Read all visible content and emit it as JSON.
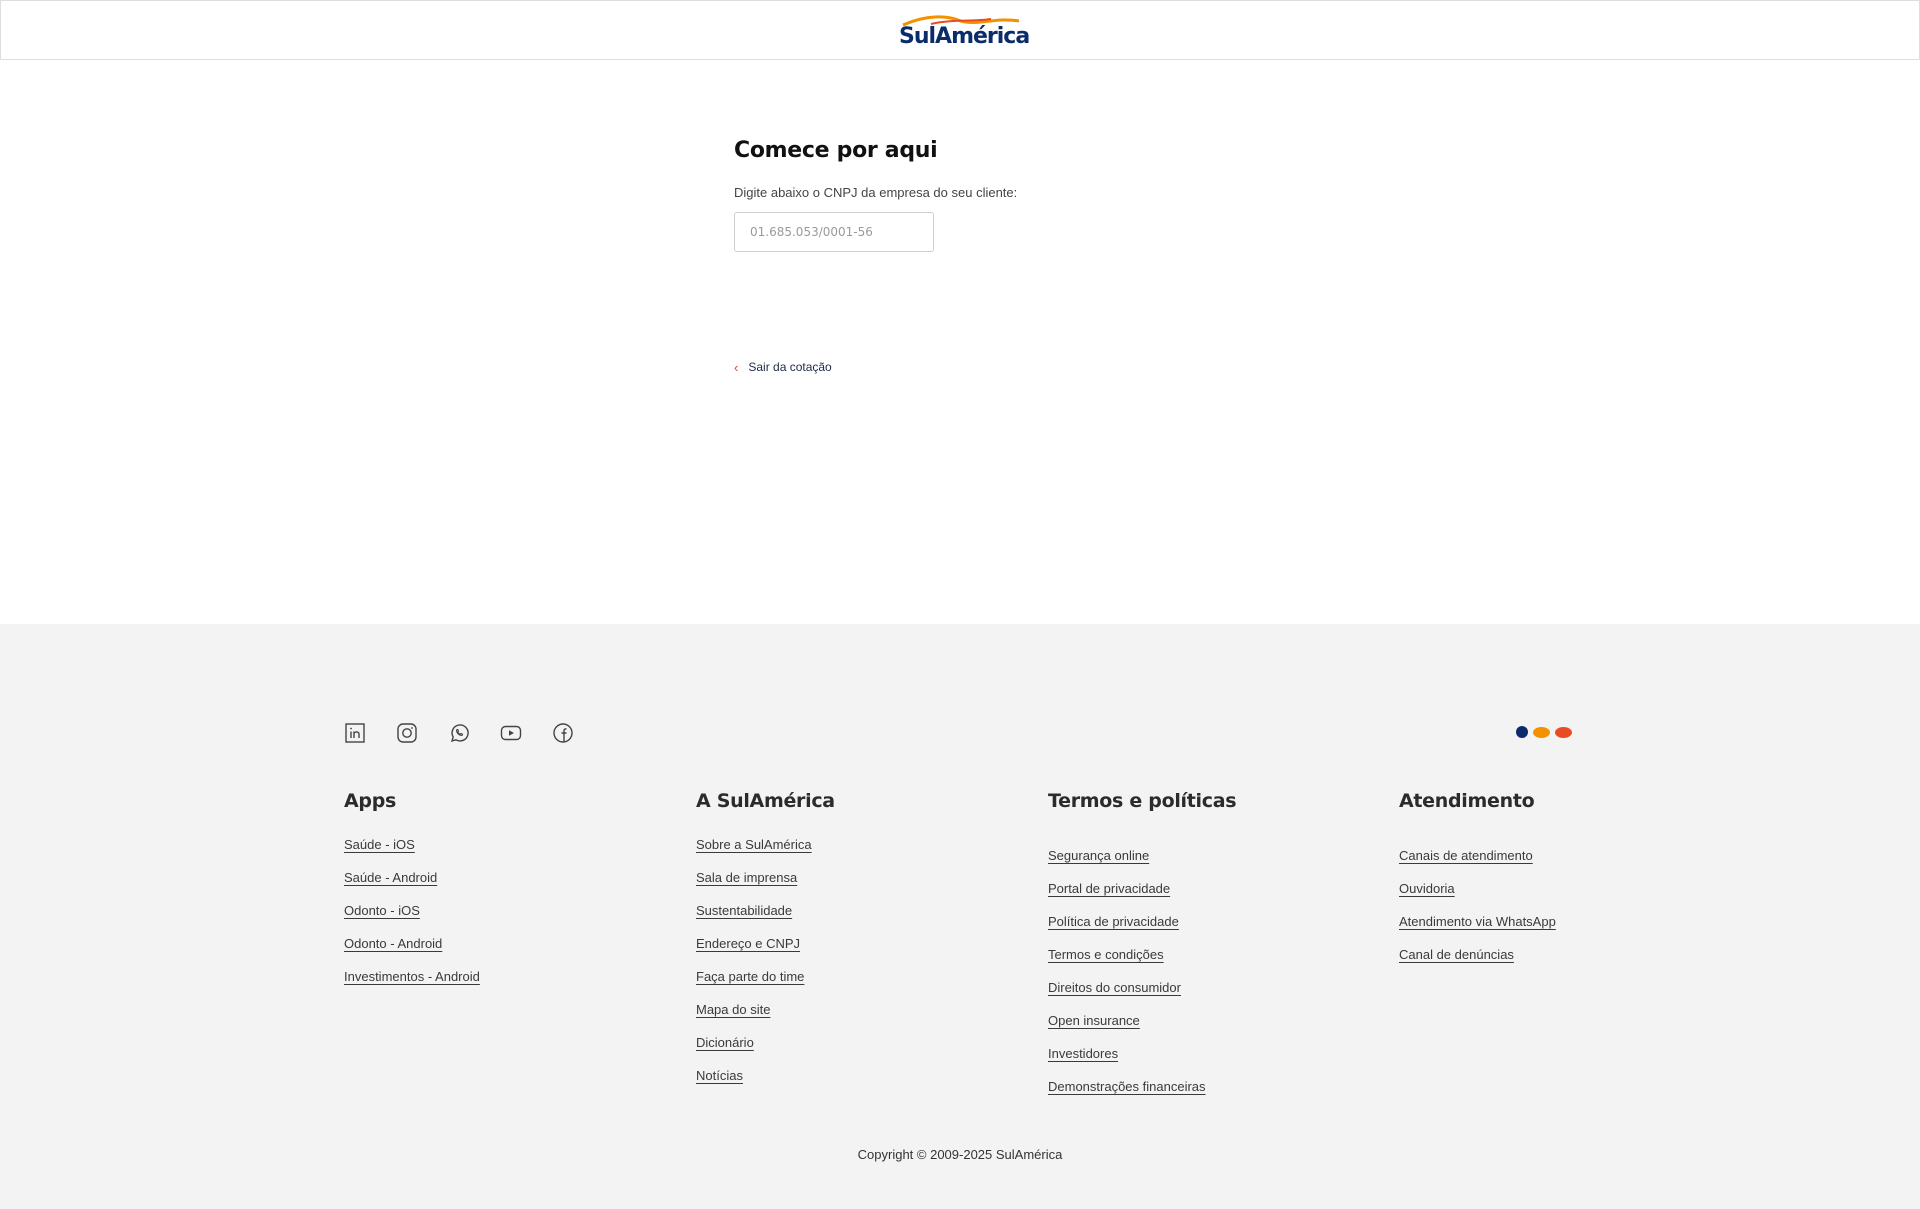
{
  "header": {
    "logo_text": "SulAmérica"
  },
  "main": {
    "title": "Comece por aqui",
    "subtitle": "Digite abaixo o CNPJ da empresa do seu cliente:",
    "cnpj_placeholder": "01.685.053/0001-56",
    "cnpj_value": "",
    "exit_label": "Sair da cotação"
  },
  "footer": {
    "social_icons": [
      "linkedin-icon",
      "instagram-icon",
      "whatsapp-icon",
      "youtube-icon",
      "facebook-icon"
    ],
    "brand_colors": {
      "navy": "#0b2c6b",
      "orange": "#f39200",
      "red": "#e84c22"
    },
    "columns": [
      {
        "title": "Apps",
        "links": [
          "Saúde - iOS",
          "Saúde - Android",
          "Odonto - iOS",
          "Odonto - Android",
          "Investimentos - Android"
        ]
      },
      {
        "title": "A SulAmérica",
        "links": [
          "Sobre a SulAmérica",
          "Sala de imprensa",
          "Sustentabilidade",
          "Endereço e CNPJ",
          "Faça parte do time",
          "Mapa do site",
          "Dicionário",
          "Notícias"
        ]
      },
      {
        "title": "Termos e políticas",
        "links": [
          "Segurança online",
          "Portal de privacidade",
          "Política de privacidade",
          "Termos e condições",
          "Direitos do consumidor",
          "Open insurance",
          "Investidores",
          "Demonstrações financeiras"
        ]
      },
      {
        "title": "Atendimento",
        "links": [
          "Canais de atendimento",
          "Ouvidoria",
          "Atendimento via WhatsApp",
          "Canal de denúncias"
        ]
      }
    ],
    "copyright": "Copyright © 2009-2025 SulAmérica"
  }
}
